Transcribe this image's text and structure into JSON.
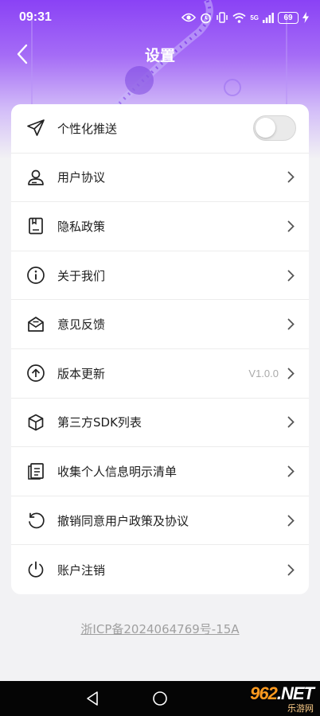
{
  "status_bar": {
    "time": "09:31",
    "battery": "69",
    "network": "5G",
    "icons": [
      "eye-icon",
      "alarm-icon",
      "vibrate-icon",
      "wifi-icon",
      "signal-icon",
      "charging-icon"
    ]
  },
  "header": {
    "title": "设置",
    "back_icon": "back-arrow-icon"
  },
  "settings": {
    "push": {
      "label": "个性化推送",
      "icon": "paper-plane-icon",
      "enabled": false
    },
    "items": [
      {
        "label": "用户协议",
        "icon": "user-agreement-icon",
        "value": ""
      },
      {
        "label": "隐私政策",
        "icon": "privacy-book-icon",
        "value": ""
      },
      {
        "label": "关于我们",
        "icon": "info-circle-icon",
        "value": ""
      },
      {
        "label": "意见反馈",
        "icon": "feedback-mail-icon",
        "value": ""
      },
      {
        "label": "版本更新",
        "icon": "upload-circle-icon",
        "value": "V1.0.0"
      },
      {
        "label": "第三方SDK列表",
        "icon": "cube-icon",
        "value": ""
      },
      {
        "label": "收集个人信息明示清单",
        "icon": "document-list-icon",
        "value": ""
      },
      {
        "label": "撤销同意用户政策及协议",
        "icon": "undo-icon",
        "value": ""
      },
      {
        "label": "账户注销",
        "icon": "power-icon",
        "value": ""
      }
    ]
  },
  "footer": {
    "icp": "浙ICP备2024064769号-15A"
  },
  "watermark": {
    "brand_number": "962",
    "brand_domain": ".NET",
    "site_name": "乐游网"
  },
  "colors": {
    "header_gradient_top": "#8a42f5",
    "page_background": "#f2f2f4",
    "card": "#ffffff",
    "navbar": "#050505"
  }
}
